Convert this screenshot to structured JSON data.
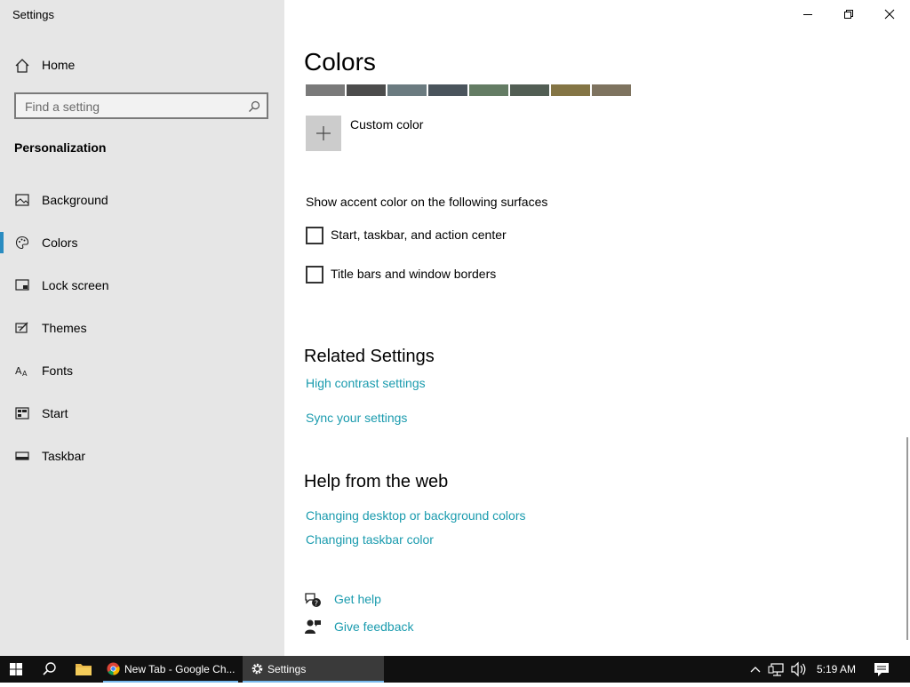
{
  "window": {
    "title": "Settings"
  },
  "sidebar": {
    "home_label": "Home",
    "search_placeholder": "Find a setting",
    "section_title": "Personalization",
    "items": [
      {
        "label": "Background",
        "icon": "image-icon"
      },
      {
        "label": "Colors",
        "icon": "palette-icon",
        "selected": true
      },
      {
        "label": "Lock screen",
        "icon": "lock-screen-icon"
      },
      {
        "label": "Themes",
        "icon": "themes-icon"
      },
      {
        "label": "Fonts",
        "icon": "fonts-icon"
      },
      {
        "label": "Start",
        "icon": "start-icon"
      },
      {
        "label": "Taskbar",
        "icon": "taskbar-icon"
      }
    ]
  },
  "main": {
    "title": "Colors",
    "swatches": [
      "#7a7a7a",
      "#4c4c4c",
      "#6b7b80",
      "#4a545c",
      "#647c64",
      "#525e54",
      "#847545",
      "#7e735f"
    ],
    "custom_color_label": "Custom color",
    "surfaces": {
      "title": "Show accent color on the following surfaces",
      "options": [
        {
          "label": "Start, taskbar, and action center",
          "checked": false
        },
        {
          "label": "Title bars and window borders",
          "checked": false
        }
      ]
    },
    "related": {
      "title": "Related Settings",
      "links": [
        "High contrast settings",
        "Sync your settings"
      ]
    },
    "help": {
      "title": "Help from the web",
      "links": [
        "Changing desktop or background colors",
        "Changing taskbar color"
      ]
    },
    "get_help": "Get help",
    "give_feedback": "Give feedback"
  },
  "taskbar": {
    "apps": [
      {
        "label": "New Tab - Google Ch...",
        "icon": "chrome-icon"
      },
      {
        "label": "Settings",
        "icon": "gear-icon",
        "active": true
      }
    ],
    "clock": "5:19 AM"
  },
  "colors": {
    "accent_link": "#1a9bae",
    "selection_bar": "#2a8cc1",
    "sidebar_bg": "#e6e6e6",
    "taskbar_bg": "#101010"
  }
}
